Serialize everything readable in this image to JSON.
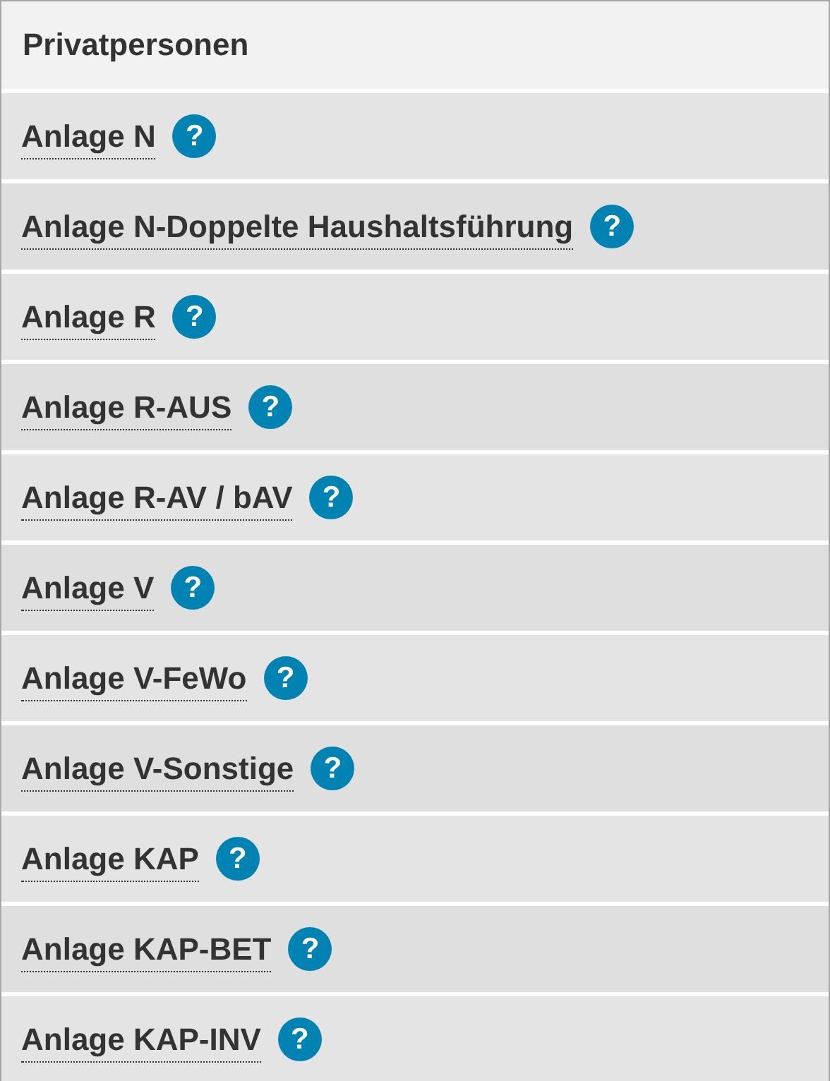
{
  "header": {
    "title": "Privatpersonen"
  },
  "items": [
    {
      "label": "Anlage N",
      "help": "?"
    },
    {
      "label": "Anlage N-Doppelte Haushaltsführung",
      "help": "?"
    },
    {
      "label": "Anlage R",
      "help": "?"
    },
    {
      "label": "Anlage R-AUS",
      "help": "?"
    },
    {
      "label": "Anlage R-AV / bAV",
      "help": "?"
    },
    {
      "label": "Anlage V",
      "help": "?"
    },
    {
      "label": "Anlage V-FeWo",
      "help": "?"
    },
    {
      "label": "Anlage V-Sonstige",
      "help": "?"
    },
    {
      "label": "Anlage KAP",
      "help": "?"
    },
    {
      "label": "Anlage KAP-BET",
      "help": "?"
    },
    {
      "label": "Anlage KAP-INV",
      "help": "?"
    }
  ]
}
